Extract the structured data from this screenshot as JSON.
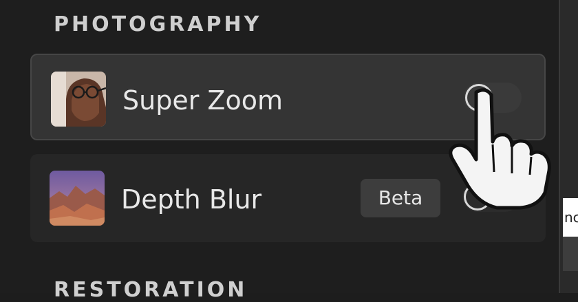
{
  "sections": {
    "photography_title": "PHOTOGRAPHY",
    "restoration_title": "RESTORATION"
  },
  "filters": [
    {
      "label": "Super Zoom",
      "badge": "",
      "enabled": false,
      "selected": true,
      "thumb_icon": "portrait-thumbnail"
    },
    {
      "label": "Depth Blur",
      "badge": "Beta",
      "enabled": false,
      "selected": false,
      "thumb_icon": "landscape-thumbnail"
    }
  ],
  "right_panel_fragment": {
    "text": "nc"
  },
  "colors": {
    "background": "#1e1e1e",
    "row_selected": "#343434",
    "row": "#262626",
    "text": "#e8e8e8"
  }
}
